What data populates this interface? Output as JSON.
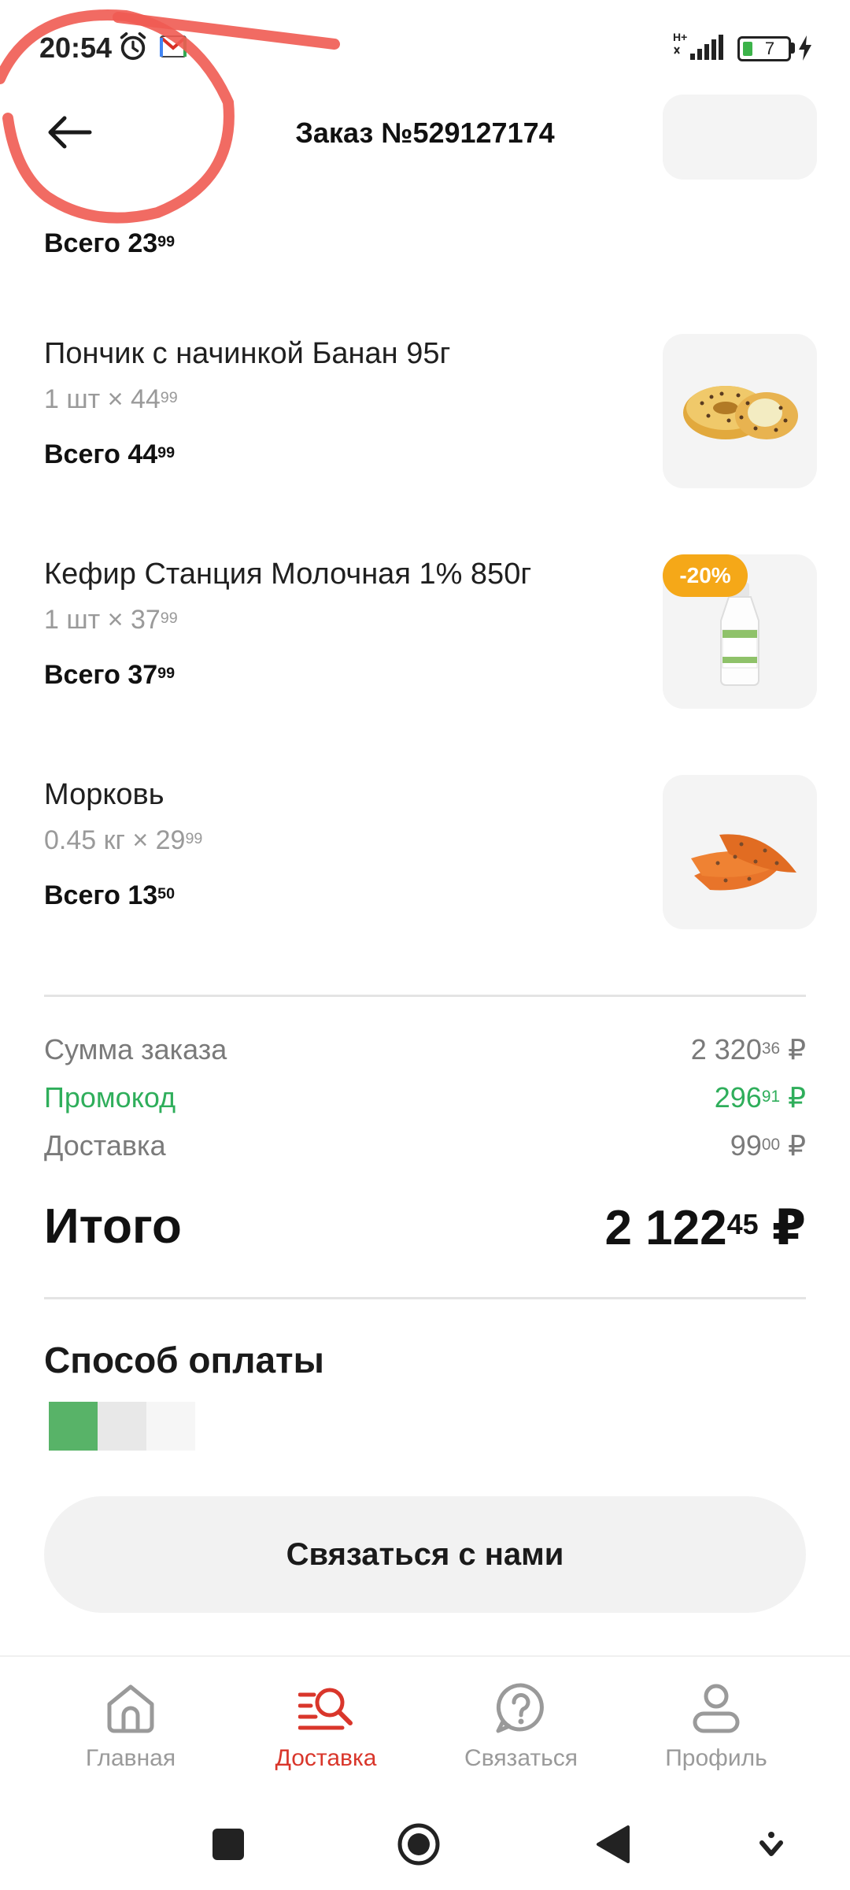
{
  "status_bar": {
    "time": "20:54",
    "network": "H+",
    "battery": "7"
  },
  "header": {
    "title": "Заказ №529127174"
  },
  "items": [
    {
      "name": "",
      "qty": "",
      "total_prefix": "Всего",
      "total_main": "23",
      "total_kop": "99",
      "image": "hidden-product"
    },
    {
      "name": "Пончик с начинкой Банан 95г",
      "qty_main": "1 шт × 44",
      "qty_kop": "99",
      "total_prefix": "Всего",
      "total_main": "44",
      "total_kop": "99",
      "image": "donut"
    },
    {
      "name": "Кефир Станция Молочная 1% 850г",
      "qty_main": "1 шт × 37",
      "qty_kop": "99",
      "total_prefix": "Всего",
      "total_main": "37",
      "total_kop": "99",
      "badge": "-20%",
      "image": "kefir-bottle"
    },
    {
      "name": "Морковь",
      "qty_main": "0.45 кг × 29",
      "qty_kop": "99",
      "total_prefix": "Всего",
      "total_main": "13",
      "total_kop": "50",
      "image": "carrots"
    }
  ],
  "summary": {
    "order_sum": {
      "label": "Сумма заказа",
      "main": "2 320",
      "kop": "36",
      "currency": "₽"
    },
    "promo": {
      "label": "Промокод",
      "main": "296",
      "kop": "91",
      "currency": "₽"
    },
    "delivery": {
      "label": "Доставка",
      "main": "99",
      "kop": "00",
      "currency": "₽"
    },
    "total": {
      "label": "Итого",
      "main": "2 122",
      "kop": "45",
      "currency": "₽"
    }
  },
  "payment": {
    "title": "Способ оплаты",
    "swatches": [
      "#58b368",
      "#e8e8e8",
      "#f6f6f6"
    ]
  },
  "contact_button": {
    "label": "Связаться с нами"
  },
  "bottom_nav": [
    {
      "label": "Главная",
      "icon": "home-icon",
      "active": false
    },
    {
      "label": "Доставка",
      "icon": "delivery-search-icon",
      "active": true
    },
    {
      "label": "Связаться",
      "icon": "help-chat-icon",
      "active": false
    },
    {
      "label": "Профиль",
      "icon": "profile-icon",
      "active": false
    }
  ],
  "colors": {
    "accent": "#d9362b",
    "promo": "#2fae5b",
    "badge": "#f5a818"
  }
}
